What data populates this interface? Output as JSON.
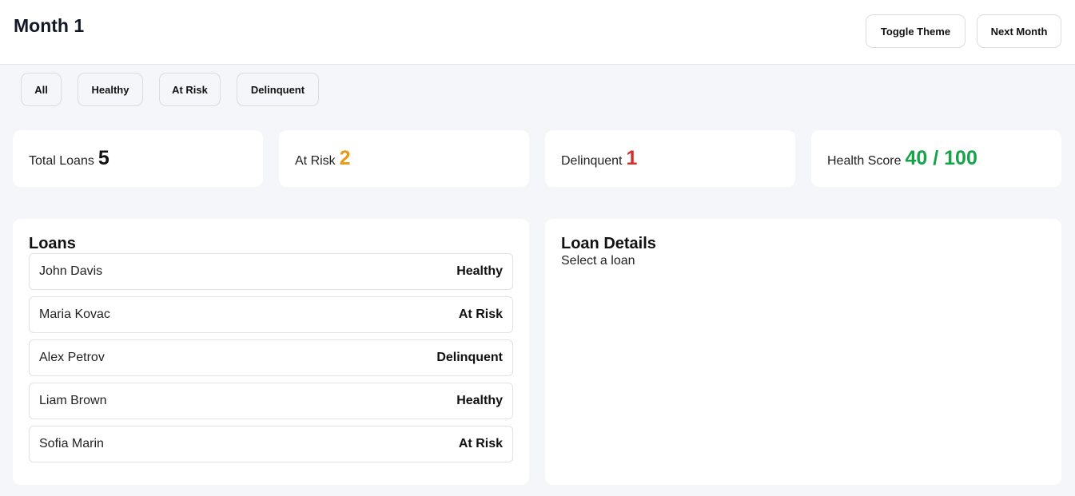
{
  "header": {
    "title": "Month 1",
    "toggle_theme_label": "Toggle Theme",
    "next_month_label": "Next Month"
  },
  "filters": [
    "All",
    "Healthy",
    "At Risk",
    "Delinquent"
  ],
  "stats": {
    "total_loans": {
      "label": "Total Loans",
      "value": "5",
      "color": "#111111"
    },
    "at_risk": {
      "label": "At Risk",
      "value": "2",
      "color": "#e89b12"
    },
    "delinquent": {
      "label": "Delinquent",
      "value": "1",
      "color": "#d32f2f"
    },
    "health_score": {
      "label": "Health Score",
      "value": "40 / 100",
      "color": "#16a34a"
    }
  },
  "loans_panel": {
    "title": "Loans",
    "loans": [
      {
        "name": "John Davis",
        "status": "Healthy"
      },
      {
        "name": "Maria Kovac",
        "status": "At Risk"
      },
      {
        "name": "Alex Petrov",
        "status": "Delinquent"
      },
      {
        "name": "Liam Brown",
        "status": "Healthy"
      },
      {
        "name": "Sofia Marin",
        "status": "At Risk"
      }
    ]
  },
  "details_panel": {
    "title": "Loan Details",
    "placeholder": "Select a loan"
  }
}
